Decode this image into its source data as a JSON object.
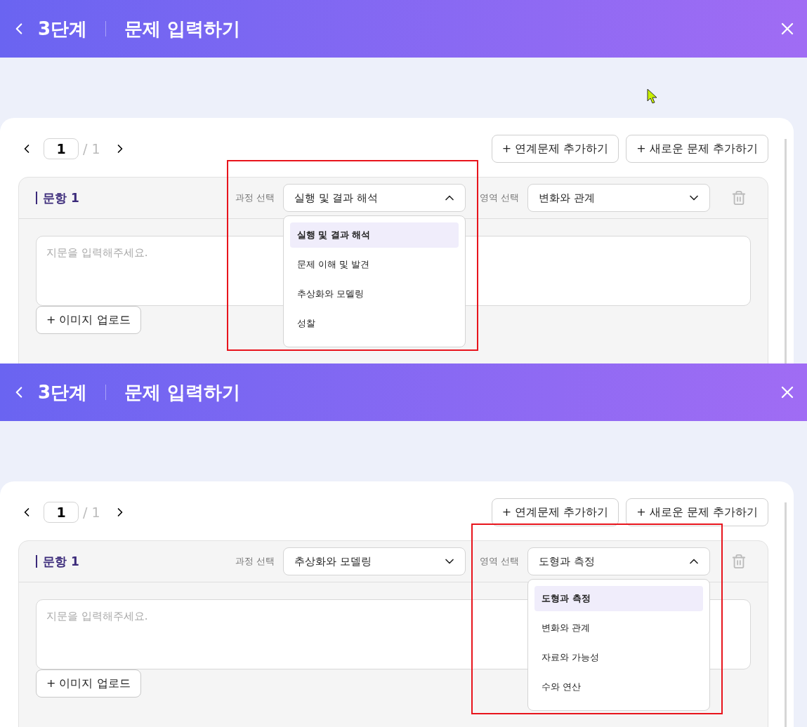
{
  "screens": [
    {
      "header": {
        "step": "3단계",
        "title": "문제 입력하기"
      },
      "pager": {
        "current": "1",
        "total": "/ 1"
      },
      "actions": [
        "+ 연계문제 추가하기",
        "+ 새로운 문제 추가하기"
      ],
      "question": {
        "label": "문항 1",
        "fields": [
          {
            "label": "과정 선택",
            "value": "실행 및 결과 해석",
            "expanded": true,
            "highlighted": true,
            "options": [
              {
                "label": "실행 및 결과 해석",
                "selected": true
              },
              {
                "label": "문제 이해 및 발견",
                "selected": false
              },
              {
                "label": "추상화와 모델링",
                "selected": false
              },
              {
                "label": "성찰",
                "selected": false
              }
            ]
          },
          {
            "label": "영역 선택",
            "value": "변화와 관계",
            "expanded": false,
            "highlighted": false
          }
        ],
        "placeholder": "지문을 입력해주세요.",
        "upload": "+ 이미지 업로드"
      },
      "cursor": true
    },
    {
      "header": {
        "step": "3단계",
        "title": "문제 입력하기"
      },
      "pager": {
        "current": "1",
        "total": "/ 1"
      },
      "actions": [
        "+ 연계문제 추가하기",
        "+ 새로운 문제 추가하기"
      ],
      "question": {
        "label": "문항 1",
        "fields": [
          {
            "label": "과정 선택",
            "value": "추상화와 모델링",
            "expanded": false,
            "highlighted": false
          },
          {
            "label": "영역 선택",
            "value": "도형과 측정",
            "expanded": true,
            "highlighted": true,
            "options": [
              {
                "label": "도형과 측정",
                "selected": true
              },
              {
                "label": "변화와 관계",
                "selected": false
              },
              {
                "label": "자료와 가능성",
                "selected": false
              },
              {
                "label": "수와 연산",
                "selected": false
              }
            ]
          }
        ],
        "placeholder": "지문을 입력해주세요.",
        "upload": "+ 이미지 업로드"
      },
      "cursor": false
    }
  ]
}
